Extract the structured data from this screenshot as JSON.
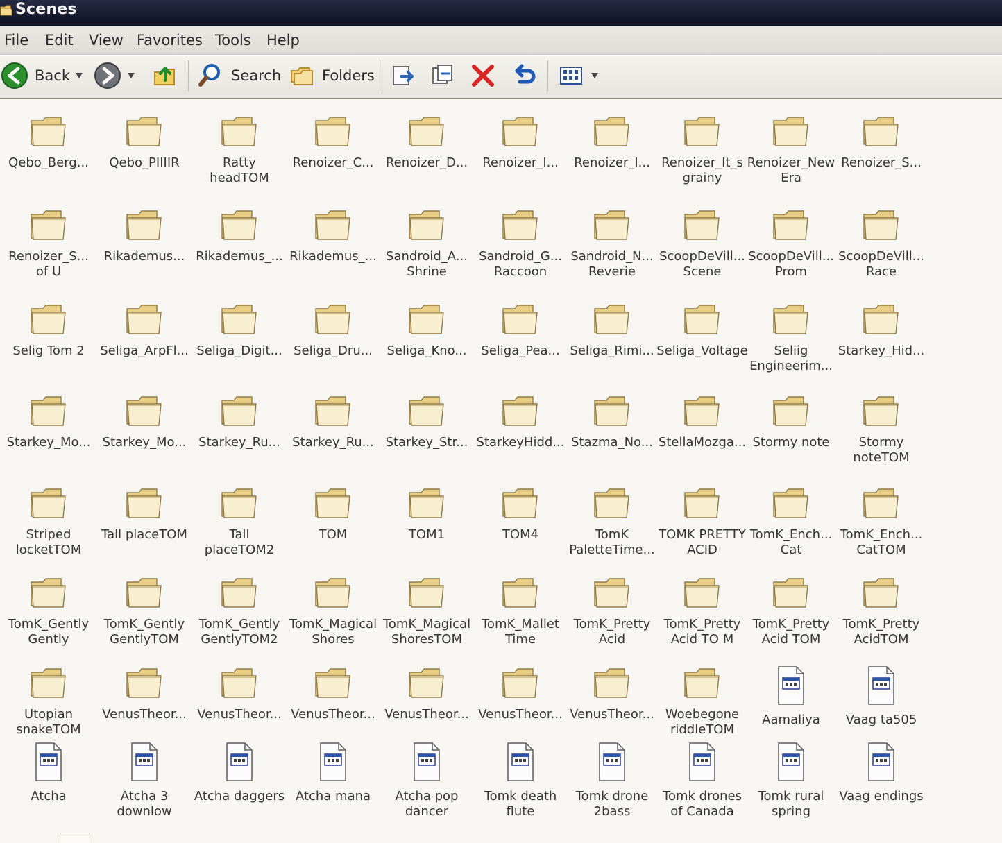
{
  "window": {
    "title": "Scenes",
    "title_icon": "folder-icon"
  },
  "menu": {
    "items": [
      {
        "label": "File"
      },
      {
        "label": "Edit"
      },
      {
        "label": "View"
      },
      {
        "label": "Favorites"
      },
      {
        "label": "Tools"
      },
      {
        "label": "Help"
      }
    ]
  },
  "toolbar": {
    "back_label": "Back",
    "search_label": "Search",
    "folders_label": "Folders",
    "icons": [
      "back-icon",
      "forward-icon",
      "up-icon",
      "search-icon",
      "folders-icon",
      "move-to-icon",
      "copy-to-icon",
      "delete-icon",
      "undo-icon",
      "views-icon"
    ]
  },
  "files": [
    {
      "label": "Qebo_Berg...",
      "type": "folder",
      "icon": "folder-icon"
    },
    {
      "label": "Qebo_PIIIIR",
      "type": "folder",
      "icon": "folder-icon"
    },
    {
      "label": "Ratty\nheadTOM",
      "type": "folder",
      "icon": "folder-icon"
    },
    {
      "label": "Renoizer_C...",
      "type": "folder",
      "icon": "folder-icon"
    },
    {
      "label": "Renoizer_D...",
      "type": "folder",
      "icon": "folder-icon"
    },
    {
      "label": "Renoizer_I...",
      "type": "folder",
      "icon": "folder-icon"
    },
    {
      "label": "Renoizer_I...",
      "type": "folder",
      "icon": "folder-icon"
    },
    {
      "label": "Renoizer_It_s\ngrainy",
      "type": "folder",
      "icon": "folder-icon"
    },
    {
      "label": "Renoizer_New\nEra",
      "type": "folder",
      "icon": "folder-icon"
    },
    {
      "label": "Renoizer_S...",
      "type": "folder",
      "icon": "folder-icon"
    },
    {
      "label": "Renoizer_S...\nof U",
      "type": "folder",
      "icon": "folder-icon"
    },
    {
      "label": "Rikademus...",
      "type": "folder",
      "icon": "folder-icon"
    },
    {
      "label": "Rikademus_...",
      "type": "folder",
      "icon": "folder-icon"
    },
    {
      "label": "Rikademus_...",
      "type": "folder",
      "icon": "folder-icon"
    },
    {
      "label": "Sandroid_A...\nShrine",
      "type": "folder",
      "icon": "folder-icon"
    },
    {
      "label": "Sandroid_G...\nRaccoon",
      "type": "folder",
      "icon": "folder-icon"
    },
    {
      "label": "Sandroid_N...\nReverie",
      "type": "folder",
      "icon": "folder-icon"
    },
    {
      "label": "ScoopDeVill...\nScene",
      "type": "folder",
      "icon": "folder-icon"
    },
    {
      "label": "ScoopDeVill...\nProm",
      "type": "folder",
      "icon": "folder-icon"
    },
    {
      "label": "ScoopDeVill...\nRace",
      "type": "folder",
      "icon": "folder-icon"
    },
    {
      "label": "Selig Tom 2",
      "type": "folder",
      "icon": "folder-icon"
    },
    {
      "label": "Seliga_ArpFl...",
      "type": "folder",
      "icon": "folder-icon"
    },
    {
      "label": "Seliga_Digit...",
      "type": "folder",
      "icon": "folder-icon"
    },
    {
      "label": "Seliga_Dru...",
      "type": "folder",
      "icon": "folder-icon"
    },
    {
      "label": "Seliga_Kno...",
      "type": "folder",
      "icon": "folder-icon"
    },
    {
      "label": "Seliga_Pea...",
      "type": "folder",
      "icon": "folder-icon"
    },
    {
      "label": "Seliga_Rimi...",
      "type": "folder",
      "icon": "folder-icon"
    },
    {
      "label": "Seliga_Voltage",
      "type": "folder",
      "icon": "folder-icon"
    },
    {
      "label": "Seliig\nEngineerim...",
      "type": "folder",
      "icon": "folder-icon"
    },
    {
      "label": "Starkey_Hid...",
      "type": "folder",
      "icon": "folder-icon"
    },
    {
      "label": "Starkey_Mo...",
      "type": "folder",
      "icon": "folder-icon"
    },
    {
      "label": "Starkey_Mo...",
      "type": "folder",
      "icon": "folder-icon"
    },
    {
      "label": "Starkey_Ru...",
      "type": "folder",
      "icon": "folder-icon"
    },
    {
      "label": "Starkey_Ru...",
      "type": "folder",
      "icon": "folder-icon"
    },
    {
      "label": "Starkey_Str...",
      "type": "folder",
      "icon": "folder-icon"
    },
    {
      "label": "StarkeyHidd...",
      "type": "folder",
      "icon": "folder-icon"
    },
    {
      "label": "Stazma_No...",
      "type": "folder",
      "icon": "folder-icon"
    },
    {
      "label": "StellaMozga...",
      "type": "folder",
      "icon": "folder-icon"
    },
    {
      "label": "Stormy note",
      "type": "folder",
      "icon": "folder-icon"
    },
    {
      "label": "Stormy\nnoteTOM",
      "type": "folder",
      "icon": "folder-icon"
    },
    {
      "label": "Striped\nlocketTOM",
      "type": "folder",
      "icon": "folder-icon"
    },
    {
      "label": "Tall placeTOM",
      "type": "folder",
      "icon": "folder-icon"
    },
    {
      "label": "Tall\nplaceTOM2",
      "type": "folder",
      "icon": "folder-icon"
    },
    {
      "label": "TOM",
      "type": "folder",
      "icon": "folder-icon"
    },
    {
      "label": "TOM1",
      "type": "folder",
      "icon": "folder-icon"
    },
    {
      "label": "TOM4",
      "type": "folder",
      "icon": "folder-icon"
    },
    {
      "label": "TomK\nPaletteTime...",
      "type": "folder",
      "icon": "folder-icon"
    },
    {
      "label": "TOMK PRETTY\nACID",
      "type": "folder",
      "icon": "folder-icon"
    },
    {
      "label": "TomK_Ench...\nCat",
      "type": "folder",
      "icon": "folder-icon"
    },
    {
      "label": "TomK_Ench...\nCatTOM",
      "type": "folder",
      "icon": "folder-icon"
    },
    {
      "label": "TomK_Gently\nGently",
      "type": "folder",
      "icon": "folder-icon"
    },
    {
      "label": "TomK_Gently\nGentlyTOM",
      "type": "folder",
      "icon": "folder-icon"
    },
    {
      "label": "TomK_Gently\nGentlyTOM2",
      "type": "folder",
      "icon": "folder-icon"
    },
    {
      "label": "TomK_Magical\nShores",
      "type": "folder",
      "icon": "folder-icon"
    },
    {
      "label": "TomK_Magical\nShoresTOM",
      "type": "folder",
      "icon": "folder-icon"
    },
    {
      "label": "TomK_Mallet\nTime",
      "type": "folder",
      "icon": "folder-icon"
    },
    {
      "label": "TomK_Pretty\nAcid",
      "type": "folder",
      "icon": "folder-icon"
    },
    {
      "label": "TomK_Pretty\nAcid TO M",
      "type": "folder",
      "icon": "folder-icon"
    },
    {
      "label": "TomK_Pretty\nAcid TOM",
      "type": "folder",
      "icon": "folder-icon"
    },
    {
      "label": "TomK_Pretty\nAcidTOM",
      "type": "folder",
      "icon": "folder-icon"
    },
    {
      "label": "Utopian\nsnakeTOM",
      "type": "folder",
      "icon": "folder-icon"
    },
    {
      "label": "VenusTheor...",
      "type": "folder",
      "icon": "folder-icon"
    },
    {
      "label": "VenusTheor...",
      "type": "folder",
      "icon": "folder-icon"
    },
    {
      "label": "VenusTheor...",
      "type": "folder",
      "icon": "folder-icon"
    },
    {
      "label": "VenusTheor...",
      "type": "folder",
      "icon": "folder-icon"
    },
    {
      "label": "VenusTheor...",
      "type": "folder",
      "icon": "folder-icon"
    },
    {
      "label": "VenusTheor...",
      "type": "folder",
      "icon": "folder-icon"
    },
    {
      "label": "Woebegone\nriddleTOM",
      "type": "folder",
      "icon": "folder-icon"
    },
    {
      "label": "Aamaliya",
      "type": "file",
      "icon": "document-icon"
    },
    {
      "label": "Vaag ta505",
      "type": "file",
      "icon": "document-icon"
    },
    {
      "label": "Atcha",
      "type": "file",
      "icon": "document-icon"
    },
    {
      "label": "Atcha 3\ndownlow",
      "type": "file",
      "icon": "document-icon"
    },
    {
      "label": "Atcha daggers",
      "type": "file",
      "icon": "document-icon"
    },
    {
      "label": "Atcha mana",
      "type": "file",
      "icon": "document-icon"
    },
    {
      "label": "Atcha pop\ndancer",
      "type": "file",
      "icon": "document-icon"
    },
    {
      "label": "Tomk death\nflute",
      "type": "file",
      "icon": "document-icon"
    },
    {
      "label": "Tomk drone\n2bass",
      "type": "file",
      "icon": "document-icon"
    },
    {
      "label": "Tomk drones\nof Canada",
      "type": "file",
      "icon": "document-icon"
    },
    {
      "label": "Tomk rural\nspring",
      "type": "file",
      "icon": "document-icon"
    },
    {
      "label": "Vaag endings",
      "type": "file",
      "icon": "document-icon"
    }
  ]
}
